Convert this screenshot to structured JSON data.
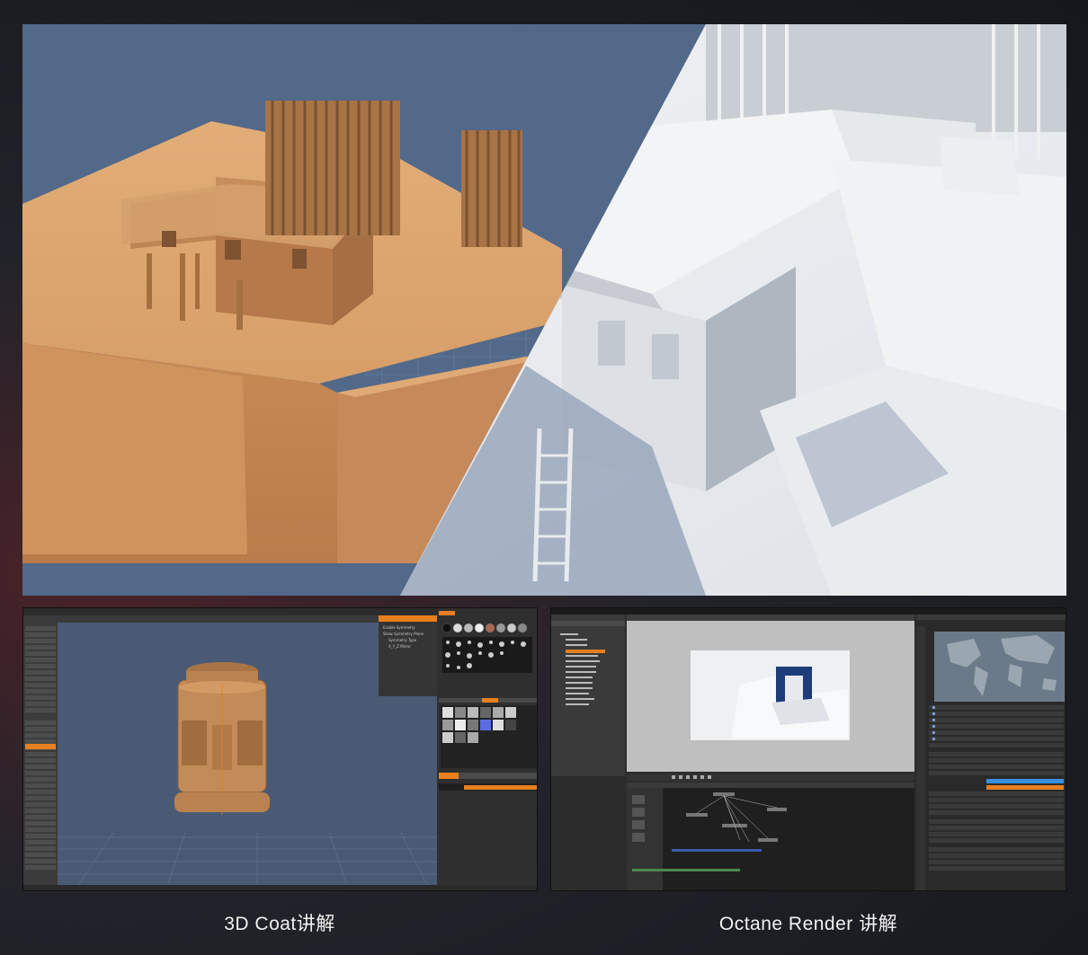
{
  "captions": {
    "left": "3D Coat讲解",
    "right": "Octane Render 讲解"
  },
  "coat": {
    "menu": [
      "Paint",
      "Tweak",
      "Retopo",
      "UV",
      "Sculpt",
      "Render"
    ],
    "active_menu": "Sculpt",
    "tools_header": "Voxel Tools",
    "tools": [
      "Grow",
      "Smooth",
      "Fill",
      "Vox Clay",
      "Carve",
      "Blob",
      "Airbrush",
      "Build",
      "Extrude",
      "Sphere",
      "Flat",
      "Scrape",
      "Pinch",
      "Smudge",
      "Vox Off",
      "Fill",
      "Measure",
      "Quick",
      "Move",
      "Pose",
      "Pull",
      "Cut",
      "Clay",
      "Inflate",
      "Expand",
      "Copy",
      "Primitives",
      "Transform"
    ],
    "active_tool": "Vox Off",
    "symmetry_title": "Symmetry",
    "symmetry_items": [
      "Enable Symmetry",
      "Show Symmetry Plane",
      "Symmetry Type",
      "X_Y_Z Mirror"
    ],
    "alphas_tab": "Alphas",
    "alphas_tabs": [
      "Brush",
      "Options",
      "Strips",
      "Models",
      "Curves"
    ],
    "shaders_tabs": [
      "Shaders",
      "Presets",
      "Stencils"
    ],
    "voxtree_title": "VoxTree",
    "voxtree_item": "Volume271",
    "status": "Object: Sculpt   Triangles: 392 406   Size: 100"
  },
  "octane": {
    "menu": [
      "File",
      "Edit",
      "Script",
      "Module",
      "Cloud",
      "Window",
      "Help"
    ],
    "outliner_title": "Scene outliner",
    "outliner_items": [
      "Scene",
      "Camera",
      "Camera",
      "Daylight environment",
      "Diffuse material",
      "Geometry group",
      "Mesh Pere 1.obj",
      "Mesh Pere 1.obj",
      "Placement",
      "Placement",
      "Placement",
      "Plane.obj",
      "Render target",
      "RGB color"
    ],
    "active_outliner_item": "Daylight environment",
    "viewport_title": "Render viewport",
    "nodegraph_title": "Nodegraph editor",
    "inspector_title": "Node inspector",
    "inspector_node": "Environment: Daylight environment",
    "inspector_type": "Daylight",
    "inspector_params": [
      {
        "label": "Sun direction",
        "value": "Sun Direction"
      },
      {
        "label": "Latitude",
        "value": "37.383"
      },
      {
        "label": "Longitude",
        "value": "-174.328"
      },
      {
        "label": "Month",
        "value": "3"
      },
      {
        "label": "Day",
        "value": "1"
      },
      {
        "label": "Local time",
        "value": "15.000"
      },
      {
        "label": "GMT offset",
        "value": "12"
      },
      {
        "label": "Sky turbidity",
        "value": "2.400"
      },
      {
        "label": "Power",
        "value": "1.116"
      },
      {
        "label": "North offset",
        "value": "0.020"
      },
      {
        "label": "Daylight model",
        "value": "New Daylight Model"
      },
      {
        "label": "Sky color",
        "value": ""
      },
      {
        "label": "Sunset color",
        "value": ""
      },
      {
        "label": "Sun size",
        "value": "1.000"
      },
      {
        "label": "Ground color",
        "value": ""
      },
      {
        "label": "Ground start angle",
        "value": "90.000"
      },
      {
        "label": "Ground blend angle",
        "value": "5.000"
      },
      {
        "label": "Sky texture",
        "value": ""
      },
      {
        "label": "Importance sampling",
        "value": ""
      },
      {
        "label": "Medium",
        "value": ""
      },
      {
        "label": "Medium radius",
        "value": "1.000"
      },
      {
        "label": "Visible environment",
        "value": ""
      },
      {
        "label": "Backplate",
        "value": ""
      },
      {
        "label": "Reflections",
        "value": ""
      },
      {
        "label": "Refractions",
        "value": ""
      }
    ]
  },
  "colors": {
    "clay": "#d9a26e",
    "accent_orange": "#e8801f",
    "octane_blue": "#3a8ee8"
  }
}
